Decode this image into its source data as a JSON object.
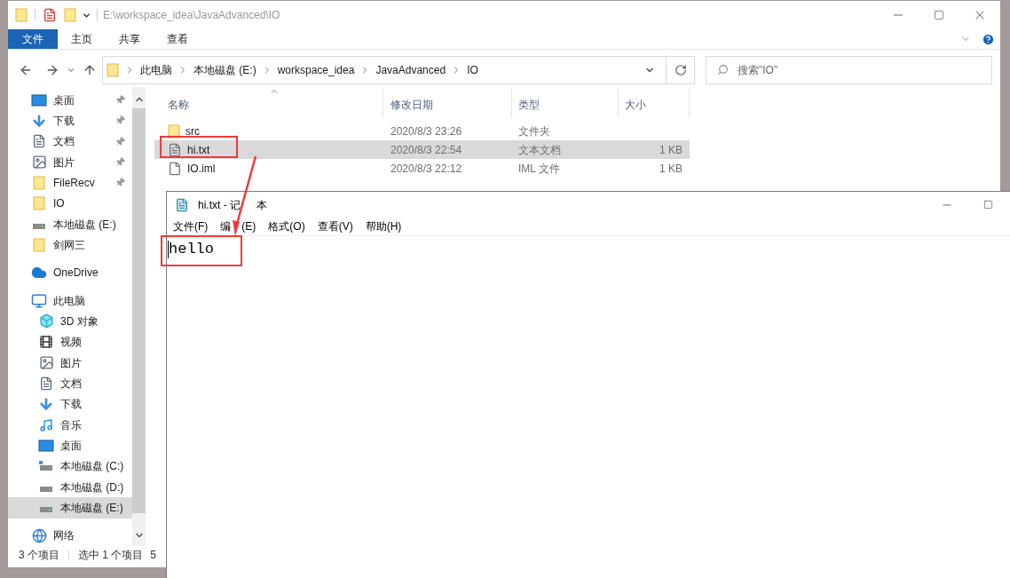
{
  "explorer": {
    "title": "E:\\workspace_idea\\JavaAdvanced\\IO",
    "ribbon_tabs": [
      {
        "label": "文件",
        "kind": "file_menu"
      },
      {
        "label": "主页",
        "kind": "tab"
      },
      {
        "label": "共享",
        "kind": "tab"
      },
      {
        "label": "查看",
        "kind": "tab"
      }
    ],
    "breadcrumbs": [
      "此电脑",
      "本地磁盘 (E:)",
      "workspace_idea",
      "JavaAdvanced",
      "IO"
    ],
    "search": {
      "placeholder": "搜索\"IO\""
    },
    "sidebar": {
      "items": [
        {
          "label": "桌面",
          "kind": "desktop",
          "pinned": true,
          "selected": false
        },
        {
          "label": "下载",
          "kind": "downloads",
          "pinned": true,
          "selected": false
        },
        {
          "label": "文档",
          "kind": "documents",
          "pinned": true,
          "selected": false
        },
        {
          "label": "图片",
          "kind": "pictures",
          "pinned": true,
          "selected": false
        },
        {
          "label": "FileRecv",
          "kind": "folder",
          "pinned": true,
          "selected": false
        },
        {
          "label": "IO",
          "kind": "folder",
          "pinned": false,
          "selected": false
        },
        {
          "label": "本地磁盘 (E:)",
          "kind": "drive",
          "pinned": false,
          "selected": false
        },
        {
          "label": "剑网三",
          "kind": "folder",
          "pinned": false,
          "selected": false
        },
        {
          "label": "OneDrive",
          "kind": "cloud",
          "pinned": false,
          "selected": false
        },
        {
          "label": "此电脑",
          "kind": "computer",
          "pinned": false,
          "selected": false,
          "children": [
            {
              "label": "3D 对象",
              "kind": "objects3d",
              "pinned": false,
              "selected": false
            },
            {
              "label": "视频",
              "kind": "videos",
              "pinned": false,
              "selected": false
            },
            {
              "label": "图片",
              "kind": "pictures",
              "pinned": false,
              "selected": false
            },
            {
              "label": "文档",
              "kind": "documents",
              "pinned": false,
              "selected": false
            },
            {
              "label": "下载",
              "kind": "downloads",
              "pinned": false,
              "selected": false
            },
            {
              "label": "音乐",
              "kind": "music",
              "pinned": false,
              "selected": false
            },
            {
              "label": "桌面",
              "kind": "desktop",
              "pinned": false,
              "selected": false
            },
            {
              "label": "本地磁盘 (C:)",
              "kind": "system_drive",
              "pinned": false,
              "selected": false
            },
            {
              "label": "本地磁盘 (D:)",
              "kind": "drive",
              "pinned": false,
              "selected": false
            },
            {
              "label": "本地磁盘 (E:)",
              "kind": "drive",
              "pinned": false,
              "selected": true
            }
          ]
        },
        {
          "label": "网络",
          "kind": "network",
          "pinned": false,
          "selected": false
        }
      ]
    },
    "columns": [
      {
        "label": "名称",
        "sorted": true
      },
      {
        "label": "修改日期",
        "sorted": false
      },
      {
        "label": "类型",
        "sorted": false
      },
      {
        "label": "大小",
        "sorted": false
      }
    ],
    "rows": [
      {
        "name": "src",
        "modified": "2020/8/3 23:26",
        "type": "文件夹",
        "kind": "folder",
        "selected": false
      },
      {
        "name": "hi.txt",
        "modified": "2020/8/3 22:54",
        "type": "文本文档",
        "size": "1 KB",
        "kind": "text",
        "selected": true
      },
      {
        "name": "IO.iml",
        "modified": "2020/8/3 22:12",
        "type": "IML 文件",
        "size": "1 KB",
        "kind": "file",
        "selected": false
      }
    ],
    "status_bar": {
      "item_count": "3 个项目",
      "selection": "选中 1 个项目",
      "size": "5"
    }
  },
  "notepad": {
    "title": [
      "hi.txt - 记",
      "本"
    ],
    "menu": [
      [
        "文件(F)"
      ],
      [
        "编",
        "(E)"
      ],
      [
        "格式(O)"
      ],
      [
        "查看(V)"
      ],
      [
        "帮助(H)"
      ]
    ],
    "content": "hello"
  }
}
